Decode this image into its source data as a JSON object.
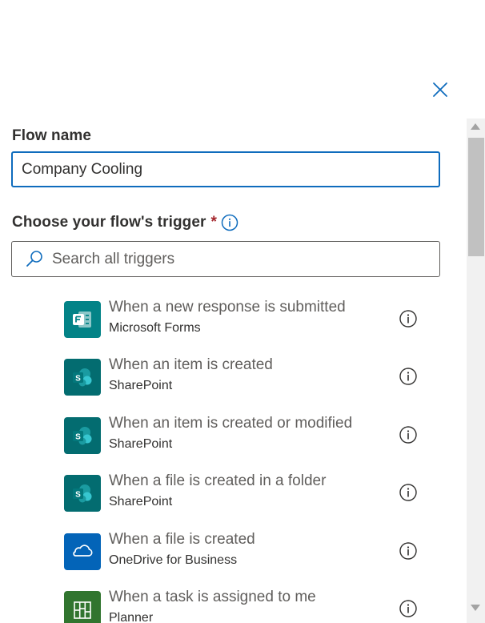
{
  "panel": {
    "close_icon": "close-icon",
    "flow_name": {
      "label": "Flow name",
      "value": "Company Cooling"
    },
    "trigger": {
      "label": "Choose your flow's trigger",
      "required_marker": "*",
      "info_icon": "info-icon"
    },
    "search": {
      "placeholder": "Search all triggers",
      "icon": "search-icon"
    },
    "triggers": [
      {
        "title": "When a new response is submitted",
        "connector": "Microsoft Forms",
        "icon": "forms-icon",
        "color": "#038387"
      },
      {
        "title": "When an item is created",
        "connector": "SharePoint",
        "icon": "sharepoint-icon",
        "color": "#036C70"
      },
      {
        "title": "When an item is created or modified",
        "connector": "SharePoint",
        "icon": "sharepoint-icon",
        "color": "#036C70"
      },
      {
        "title": "When a file is created in a folder",
        "connector": "SharePoint",
        "icon": "sharepoint-icon",
        "color": "#036C70"
      },
      {
        "title": "When a file is created",
        "connector": "OneDrive for Business",
        "icon": "onedrive-icon",
        "color": "#0364B8"
      },
      {
        "title": "When a task is assigned to me",
        "connector": "Planner",
        "icon": "planner-icon",
        "color": "#31752F"
      }
    ]
  },
  "colors": {
    "accent": "#0f6cbd",
    "required": "#a4262c"
  }
}
